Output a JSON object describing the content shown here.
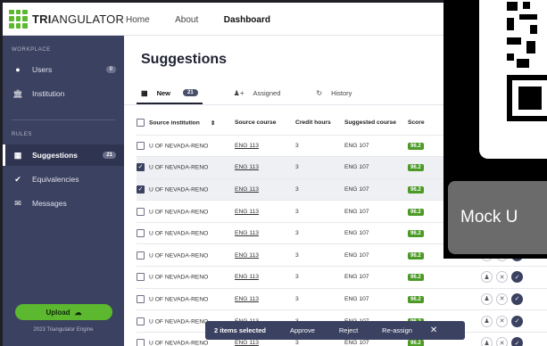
{
  "app": {
    "logo_bold": "TRI",
    "logo_rest": "ANGULATOR",
    "nav": [
      "Home",
      "About",
      "Dashboard"
    ],
    "active_nav": "Dashboard"
  },
  "sidebar": {
    "section_workplace": "WORKPLACE",
    "section_rules": "RULES",
    "items": [
      {
        "label": "Users",
        "badge": "8",
        "icon": "user-icon"
      },
      {
        "label": "Institution",
        "badge": "",
        "icon": "institution-icon"
      },
      {
        "label": "Suggestions",
        "badge": "21",
        "icon": "grid-icon"
      },
      {
        "label": "Equivalencies",
        "badge": "",
        "icon": "check-circle-icon"
      },
      {
        "label": "Messages",
        "badge": "",
        "icon": "mail-icon"
      }
    ],
    "upload_label": "Upload",
    "footer": "2023 Triangulator Engine"
  },
  "main": {
    "title": "Suggestions",
    "tabs": [
      {
        "label": "New",
        "count": "21"
      },
      {
        "label": "Assigned",
        "count": ""
      },
      {
        "label": "History",
        "count": ""
      }
    ],
    "table": {
      "headers": [
        "Source institution",
        "Source course",
        "Credit hours",
        "Suggested course",
        "Score"
      ],
      "rows": [
        {
          "inst": "U OF NEVADA-RENO",
          "course": "ENG 113",
          "hours": "3",
          "suggested": "ENG 107",
          "score": "96.2",
          "checked": false
        },
        {
          "inst": "U OF NEVADA-RENO",
          "course": "ENG 113",
          "hours": "3",
          "suggested": "ENG 107",
          "score": "96.2",
          "checked": true
        },
        {
          "inst": "U OF NEVADA-RENO",
          "course": "ENG 113",
          "hours": "3",
          "suggested": "ENG 107",
          "score": "96.2",
          "checked": true
        },
        {
          "inst": "U OF NEVADA-RENO",
          "course": "ENG 113",
          "hours": "3",
          "suggested": "ENG 107",
          "score": "96.2",
          "checked": false
        },
        {
          "inst": "U OF NEVADA-RENO",
          "course": "ENG 113",
          "hours": "3",
          "suggested": "ENG 107",
          "score": "96.2",
          "checked": false
        },
        {
          "inst": "U OF NEVADA-RENO",
          "course": "ENG 113",
          "hours": "3",
          "suggested": "ENG 107",
          "score": "96.2",
          "checked": false
        },
        {
          "inst": "U OF NEVADA-RENO",
          "course": "ENG 113",
          "hours": "3",
          "suggested": "ENG 107",
          "score": "96.2",
          "checked": false
        },
        {
          "inst": "U OF NEVADA-RENO",
          "course": "ENG 113",
          "hours": "3",
          "suggested": "ENG 107",
          "score": "96.2",
          "checked": false
        },
        {
          "inst": "U OF NEVADA-RENO",
          "course": "ENG 113",
          "hours": "3",
          "suggested": "ENG 107",
          "score": "96.2",
          "checked": false
        },
        {
          "inst": "U OF NEVADA-RENO",
          "course": "ENG 113",
          "hours": "3",
          "suggested": "ENG 107",
          "score": "96.2",
          "checked": false
        }
      ]
    }
  },
  "selection_bar": {
    "count_label": "2 items selected",
    "approve": "Approve",
    "reject": "Reject",
    "reassign": "Re-assign"
  },
  "overlay": {
    "toast_text": "Mock U"
  },
  "colors": {
    "sidebar": "#3b4160",
    "accent_green": "#5cb82f",
    "score_green": "#4c9a26"
  }
}
